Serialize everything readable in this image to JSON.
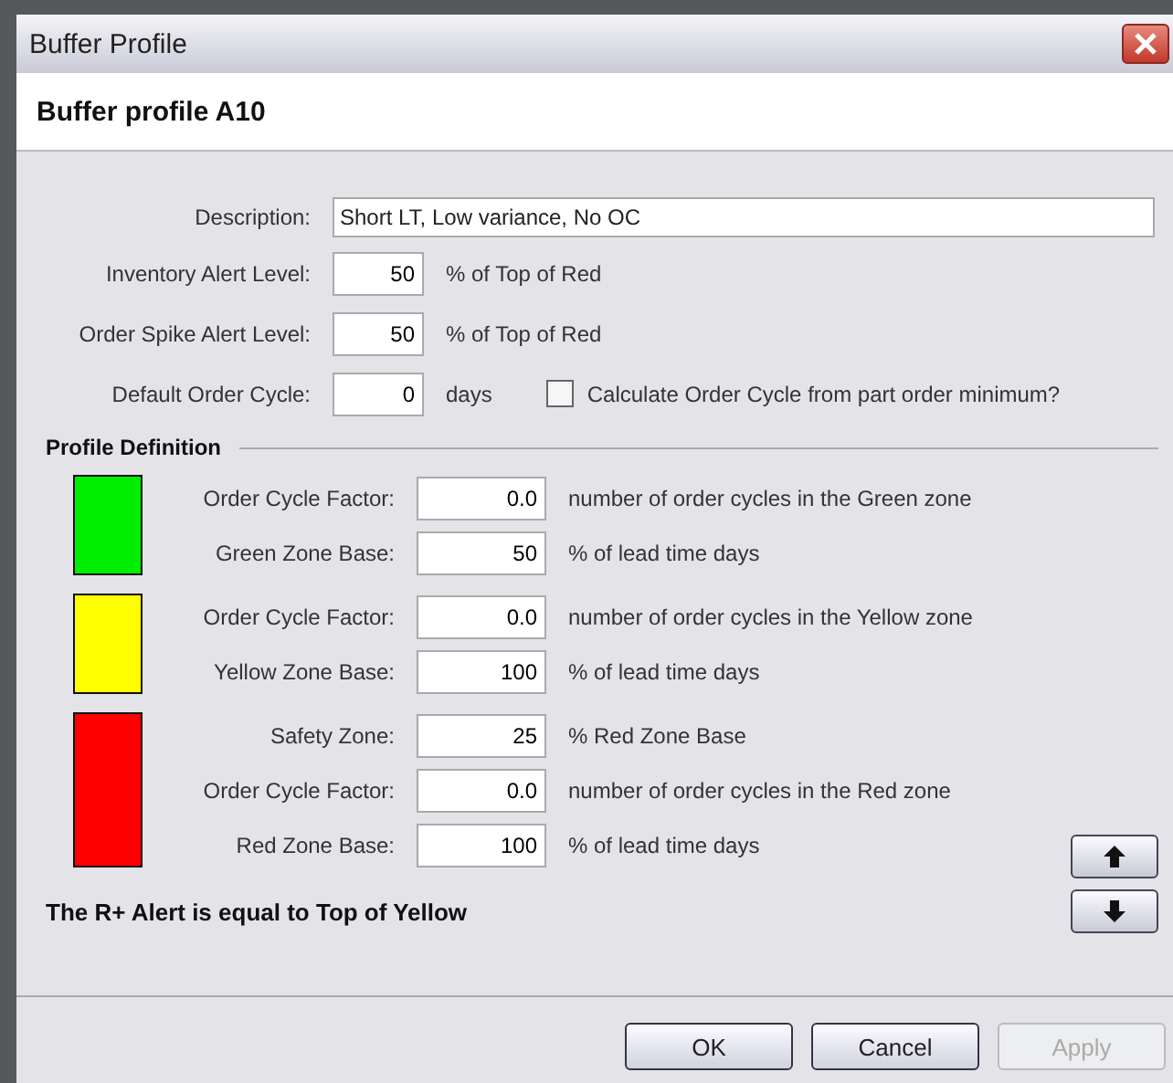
{
  "window": {
    "title": "Buffer Profile"
  },
  "header": "Buffer profile A10",
  "description": {
    "label": "Description:",
    "value": "Short LT, Low variance, No OC"
  },
  "settings": [
    {
      "label": "Inventory Alert Level:",
      "value": "50",
      "unit": "% of Top of Red"
    },
    {
      "label": "Order Spike Alert Level:",
      "value": "50",
      "unit": "% of Top of Red"
    },
    {
      "label": "Default Order Cycle:",
      "value": "0",
      "unit": "days"
    }
  ],
  "order_cycle_checkbox": {
    "label": "Calculate Order Cycle from part order minimum?",
    "checked": false
  },
  "section_title": "Profile Definition",
  "zones": [
    {
      "color": "#00ee00",
      "fields": [
        {
          "label": "Order Cycle Factor:",
          "value": "0.0",
          "unit": "number of order cycles in the Green zone"
        },
        {
          "label": "Green Zone Base:",
          "value": "50",
          "unit": "% of lead time days"
        }
      ]
    },
    {
      "color": "#ffff00",
      "fields": [
        {
          "label": "Order Cycle Factor:",
          "value": "0.0",
          "unit": "number of order cycles in the Yellow zone"
        },
        {
          "label": "Yellow Zone Base:",
          "value": "100",
          "unit": "% of lead time days"
        }
      ]
    },
    {
      "color": "#ff0000",
      "fields": [
        {
          "label": "Safety Zone:",
          "value": "25",
          "unit": "% Red Zone Base"
        },
        {
          "label": "Order Cycle Factor:",
          "value": "0.0",
          "unit": "number of order cycles in the Red zone"
        },
        {
          "label": "Red Zone Base:",
          "value": "100",
          "unit": "% of lead time days"
        }
      ]
    }
  ],
  "alert_note": "The R+ Alert is equal to Top of Yellow",
  "buttons": [
    {
      "label": "OK",
      "disabled": false
    },
    {
      "label": "Cancel",
      "disabled": false
    },
    {
      "label": "Apply",
      "disabled": true
    }
  ]
}
